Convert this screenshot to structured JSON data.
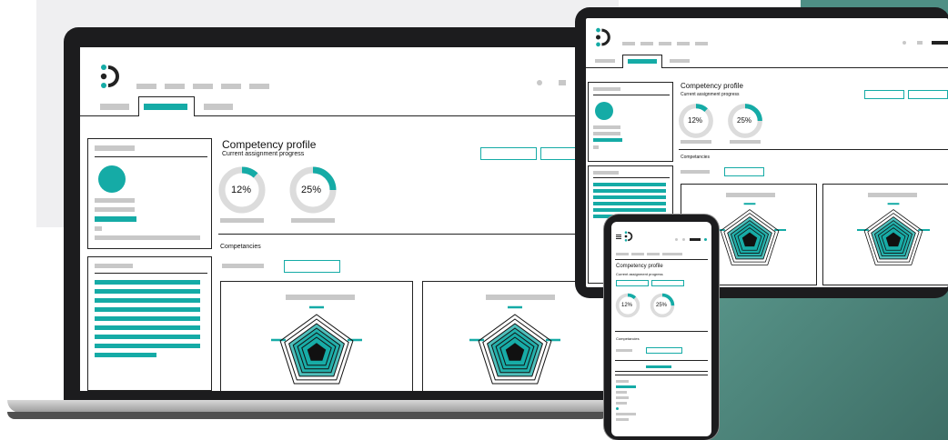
{
  "profile": {
    "title": "Competency profile",
    "subtitle": "Current assignment progress",
    "progress": [
      {
        "label": "12%",
        "value": 0.12
      },
      {
        "label": "25%",
        "value": 0.25
      }
    ],
    "section_label": "Competancies"
  },
  "colors": {
    "accent": "#15aba6",
    "placeholder": "#c8c8c8",
    "ring_track": "#dcdcdc",
    "device_frame": "#1c1c1e",
    "background_panel": "#efeff1",
    "corner_gradient_start": "#4e8f85",
    "corner_gradient_end": "#3c6b63"
  },
  "icons": {
    "logo": "brand-logo-icon",
    "menu": "hamburger-menu-icon",
    "radar": "radar-chart-icon"
  }
}
